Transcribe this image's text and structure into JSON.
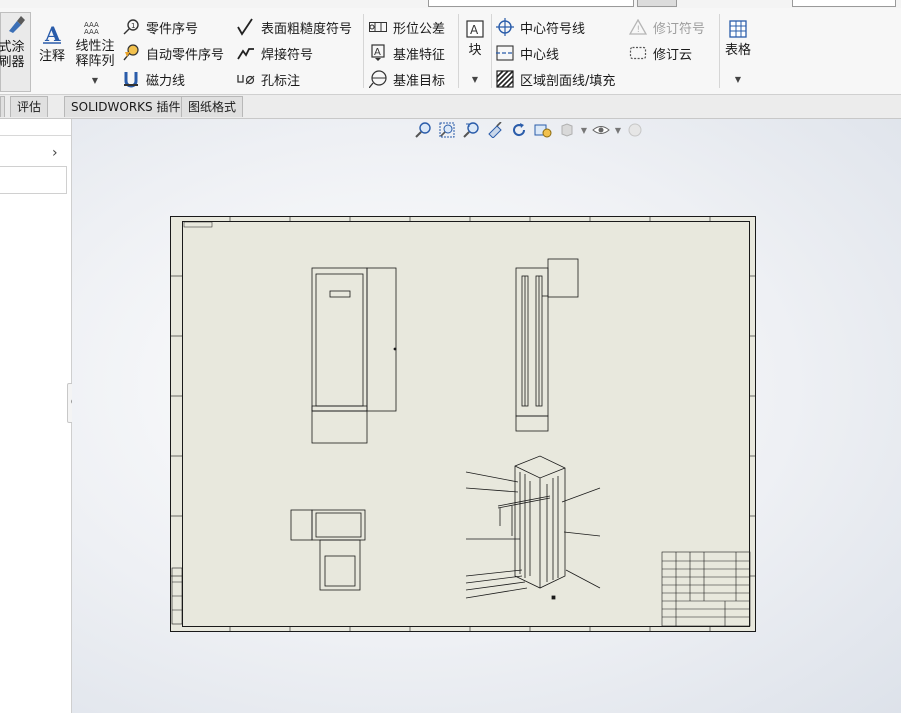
{
  "ribbon": {
    "paint_format": {
      "line1": "式涂",
      "line2": "刷器"
    },
    "note": "注释",
    "linear_pattern": {
      "line1": "线性注",
      "line2": "释阵列"
    },
    "col1": {
      "balloon": "零件序号",
      "auto_balloon": "自动零件序号",
      "magnetic_line": "磁力线"
    },
    "col2": {
      "surface_finish": "表面粗糙度符号",
      "weld_symbol": "焊接符号",
      "hole_callout": "孔标注"
    },
    "col3": {
      "gtol": "形位公差",
      "datum_feature": "基准特征",
      "datum_target": "基准目标"
    },
    "block": "块",
    "col4": {
      "center_mark": "中心符号线",
      "centerline": "中心线",
      "area_hatch": "区域剖面线/填充"
    },
    "col5": {
      "revision_symbol": "修订符号",
      "revision_cloud": "修订云"
    },
    "tables": "表格"
  },
  "tabs": {
    "evaluate": "评估",
    "solidworks_addins": "SOLIDWORKS 插件",
    "sheet_format": "图纸格式"
  },
  "colors": {
    "sheet_bg": "#e8e8dd",
    "line": "#1a1a1a",
    "accent_blue": "#2a5caa"
  }
}
